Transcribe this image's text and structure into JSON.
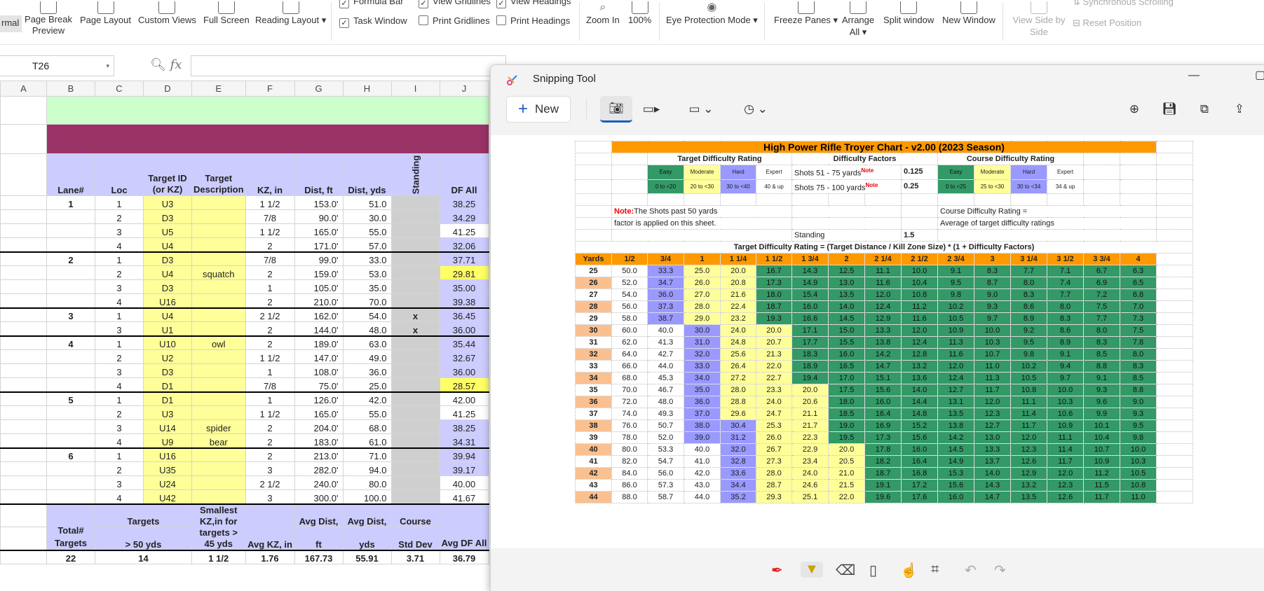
{
  "ribbon": {
    "normal": "rmal",
    "page_break": "Page Break Preview",
    "page_layout": "Page Layout",
    "custom_views": "Custom Views",
    "full_screen": "Full Screen",
    "reading_layout": "Reading Layout",
    "formula_bar": "Formula Bar",
    "task_window": "Task Window",
    "view_gridlines": "View Gridlines",
    "print_gridlines": "Print Gridlines",
    "view_headings": "View Headings",
    "print_headings": "Print Headings",
    "zoom_in": "Zoom In",
    "zoom_100": "100%",
    "eye_protection": "Eye Protection Mode",
    "freeze_panes": "Freeze Panes",
    "arrange_all": "Arrange All",
    "split_window": "Split window",
    "new_window": "New Window",
    "view_side": "View Side by Side",
    "sync_scroll": "Synchronous Scrolling",
    "reset_position": "Reset Position"
  },
  "formula": {
    "cell": "T26",
    "fx": "fx",
    "value": ""
  },
  "sheet": {
    "cols": [
      "A",
      "B",
      "C",
      "D",
      "E",
      "F",
      "G",
      "H",
      "I",
      "J"
    ],
    "headers": {
      "lane": "Lane#",
      "loc": "Loc",
      "target_id": "Target ID (or KZ)",
      "target_desc": "Target Description",
      "kz": "KZ, in",
      "dist_ft": "Dist, ft",
      "dist_yds": "Dist, yds",
      "standing": "Standing",
      "df": "DF All"
    },
    "rows": [
      {
        "lane": "1",
        "loc": "1",
        "id": "U3",
        "desc": "",
        "kz": "1  1/2",
        "ft": "153.0'",
        "yds": "51.0",
        "st": "",
        "df": "38.25",
        "dfc": "lb",
        "top": false
      },
      {
        "lane": "",
        "loc": "2",
        "id": "D3",
        "desc": "",
        "kz": "7/8",
        "ft": "90.0'",
        "yds": "30.0",
        "st": "",
        "df": "34.29",
        "dfc": "lb",
        "top": false
      },
      {
        "lane": "",
        "loc": "3",
        "id": "U5",
        "desc": "",
        "kz": "1  1/2",
        "ft": "165.0'",
        "yds": "55.0",
        "st": "",
        "df": "41.25",
        "dfc": "",
        "top": false
      },
      {
        "lane": "",
        "loc": "4",
        "id": "U4",
        "desc": "",
        "kz": "2",
        "ft": "171.0'",
        "yds": "57.0",
        "st": "",
        "df": "32.06",
        "dfc": "lb",
        "top": false
      },
      {
        "lane": "2",
        "loc": "1",
        "id": "D3",
        "desc": "",
        "kz": "7/8",
        "ft": "99.0'",
        "yds": "33.0",
        "st": "",
        "df": "37.71",
        "dfc": "lb",
        "top": true
      },
      {
        "lane": "",
        "loc": "2",
        "id": "U4",
        "desc": "squatch",
        "kz": "2",
        "ft": "159.0'",
        "yds": "53.0",
        "st": "",
        "df": "29.81",
        "dfc": "org",
        "top": false
      },
      {
        "lane": "",
        "loc": "3",
        "id": "D3",
        "desc": "",
        "kz": "1",
        "ft": "105.0'",
        "yds": "35.0",
        "st": "",
        "df": "35.00",
        "dfc": "lb",
        "top": false
      },
      {
        "lane": "",
        "loc": "4",
        "id": "U16",
        "desc": "",
        "kz": "2",
        "ft": "210.0'",
        "yds": "70.0",
        "st": "",
        "df": "39.38",
        "dfc": "lb",
        "top": false
      },
      {
        "lane": "3",
        "loc": "1",
        "id": "U4",
        "desc": "",
        "kz": "2  1/2",
        "ft": "162.0'",
        "yds": "54.0",
        "st": "x",
        "df": "36.45",
        "dfc": "lb",
        "top": true
      },
      {
        "lane": "",
        "loc": "3",
        "id": "U1",
        "desc": "",
        "kz": "2",
        "ft": "144.0'",
        "yds": "48.0",
        "st": "x",
        "df": "36.00",
        "dfc": "lb",
        "top": false
      },
      {
        "lane": "4",
        "loc": "1",
        "id": "U10",
        "desc": "owl",
        "kz": "2",
        "ft": "189.0'",
        "yds": "63.0",
        "st": "",
        "df": "35.44",
        "dfc": "lb",
        "top": true
      },
      {
        "lane": "",
        "loc": "2",
        "id": "U2",
        "desc": "",
        "kz": "1  1/2",
        "ft": "147.0'",
        "yds": "49.0",
        "st": "",
        "df": "32.67",
        "dfc": "lb",
        "top": false
      },
      {
        "lane": "",
        "loc": "3",
        "id": "D3",
        "desc": "",
        "kz": "1",
        "ft": "108.0'",
        "yds": "36.0",
        "st": "",
        "df": "36.00",
        "dfc": "lb",
        "top": false
      },
      {
        "lane": "",
        "loc": "4",
        "id": "D1",
        "desc": "",
        "kz": "7/8",
        "ft": "75.0'",
        "yds": "25.0",
        "st": "",
        "df": "28.57",
        "dfc": "org",
        "top": false
      },
      {
        "lane": "5",
        "loc": "1",
        "id": "D1",
        "desc": "",
        "kz": "1",
        "ft": "126.0'",
        "yds": "42.0",
        "st": "",
        "df": "42.00",
        "dfc": "",
        "top": true
      },
      {
        "lane": "",
        "loc": "2",
        "id": "U3",
        "desc": "",
        "kz": "1  1/2",
        "ft": "165.0'",
        "yds": "55.0",
        "st": "",
        "df": "41.25",
        "dfc": "",
        "top": false
      },
      {
        "lane": "",
        "loc": "3",
        "id": "U14",
        "desc": "spider",
        "kz": "2",
        "ft": "204.0'",
        "yds": "68.0",
        "st": "",
        "df": "38.25",
        "dfc": "lb",
        "top": false
      },
      {
        "lane": "",
        "loc": "4",
        "id": "U9",
        "desc": "bear",
        "kz": "2",
        "ft": "183.0'",
        "yds": "61.0",
        "st": "",
        "df": "34.31",
        "dfc": "lb",
        "top": false
      },
      {
        "lane": "6",
        "loc": "1",
        "id": "U16",
        "desc": "",
        "kz": "2",
        "ft": "213.0'",
        "yds": "71.0",
        "st": "",
        "df": "39.94",
        "dfc": "lb",
        "top": true
      },
      {
        "lane": "",
        "loc": "2",
        "id": "U35",
        "desc": "",
        "kz": "3",
        "ft": "282.0'",
        "yds": "94.0",
        "st": "",
        "df": "39.17",
        "dfc": "lb",
        "top": false
      },
      {
        "lane": "",
        "loc": "3",
        "id": "U24",
        "desc": "",
        "kz": "2  1/2",
        "ft": "240.0'",
        "yds": "80.0",
        "st": "",
        "df": "40.00",
        "dfc": "",
        "top": false
      },
      {
        "lane": "",
        "loc": "4",
        "id": "U42",
        "desc": "",
        "kz": "3",
        "ft": "300.0'",
        "yds": "100.0",
        "st": "",
        "df": "41.67",
        "dfc": "",
        "top": false
      }
    ],
    "summary_headers": {
      "total": "Total# Targets",
      "targets": "Targets",
      "targets2": "> 50 yds",
      "smallest": "Smallest KZ,in for targets > 45 yds",
      "avg_kz": "Avg KZ, in",
      "avg_dist_ft1": "Avg Dist,",
      "avg_dist_ft2": "ft",
      "avg_dist_yd1": "Avg Dist,",
      "avg_dist_yd2": "yds",
      "course1": "Course",
      "course2": "Std Dev",
      "avg_df": "Avg DF All"
    },
    "summary": {
      "total": "22",
      "targets": "14",
      "smallest": "1  1/2",
      "avg_kz": "1.76",
      "avg_ft": "167.73",
      "avg_yds": "55.91",
      "std": "3.71",
      "avg_df": "36.79"
    }
  },
  "snip": {
    "title": "Snipping Tool",
    "new_label": "New",
    "chart": {
      "title": "High Power Rifle Troyer Chart - v2.00 (2023 Season)",
      "tdr_title": "Target Difficulty Rating",
      "tdr": [
        {
          "name": "Easy",
          "range": "0 to <20"
        },
        {
          "name": "Moderate",
          "range": "20 to <30"
        },
        {
          "name": "Hard",
          "range": "30 to <40"
        },
        {
          "name": "Expert",
          "range": "40 & up"
        }
      ],
      "df_title": "Difficulty Factors",
      "df1_label": "Shots 51 - 75 yards",
      "df1_val": "0.125",
      "df2_label": "Shots 75 - 100 yards",
      "df2_val": "0.25",
      "note_sup": "Note",
      "cdr_title": "Course Difficulty Rating",
      "cdr": [
        {
          "name": "Easy",
          "range": "0 to <25"
        },
        {
          "name": "Moderate",
          "range": "25 to <30"
        },
        {
          "name": "Hard",
          "range": "30 to <34"
        },
        {
          "name": "Expert",
          "range": "34 & up"
        }
      ],
      "note_label": "Note:",
      "note1": "The Shots past 50 yards",
      "note2": "factor is applied on this sheet.",
      "cdr_eq": "Course Difficulty Rating =",
      "cdr_avg": "Average of target difficulty ratings",
      "standing_label": "Standing",
      "standing_val": "1.5",
      "formula": "Target Difficulty Rating = (Target Distance / Kill Zone Size) * (1 + Difficulty Factors)",
      "yards_label": "Yards",
      "kz_headers": [
        "1/2",
        "3/4",
        "1",
        "1 1/4",
        "1 1/2",
        "1 3/4",
        "2",
        "2 1/4",
        "2 1/2",
        "2 3/4",
        "3",
        "3 1/4",
        "3 1/2",
        "3 3/4",
        "4"
      ],
      "rows": [
        [
          "25",
          "50.0",
          "33.3",
          "25.0",
          "20.0",
          "16.7",
          "14.3",
          "12.5",
          "11.1",
          "10.0",
          "9.1",
          "8.3",
          "7.7",
          "7.1",
          "6.7",
          "6.3"
        ],
        [
          "26",
          "52.0",
          "34.7",
          "26.0",
          "20.8",
          "17.3",
          "14.9",
          "13.0",
          "11.6",
          "10.4",
          "9.5",
          "8.7",
          "8.0",
          "7.4",
          "6.9",
          "6.5"
        ],
        [
          "27",
          "54.0",
          "36.0",
          "27.0",
          "21.6",
          "18.0",
          "15.4",
          "13.5",
          "12.0",
          "10.8",
          "9.8",
          "9.0",
          "8.3",
          "7.7",
          "7.2",
          "6.8"
        ],
        [
          "28",
          "56.0",
          "37.3",
          "28.0",
          "22.4",
          "18.7",
          "16.0",
          "14.0",
          "12.4",
          "11.2",
          "10.2",
          "9.3",
          "8.6",
          "8.0",
          "7.5",
          "7.0"
        ],
        [
          "29",
          "58.0",
          "38.7",
          "29.0",
          "23.2",
          "19.3",
          "16.6",
          "14.5",
          "12.9",
          "11.6",
          "10.5",
          "9.7",
          "8.9",
          "8.3",
          "7.7",
          "7.3"
        ],
        [
          "30",
          "60.0",
          "40.0",
          "30.0",
          "24.0",
          "20.0",
          "17.1",
          "15.0",
          "13.3",
          "12.0",
          "10.9",
          "10.0",
          "9.2",
          "8.6",
          "8.0",
          "7.5"
        ],
        [
          "31",
          "62.0",
          "41.3",
          "31.0",
          "24.8",
          "20.7",
          "17.7",
          "15.5",
          "13.8",
          "12.4",
          "11.3",
          "10.3",
          "9.5",
          "8.9",
          "8.3",
          "7.8"
        ],
        [
          "32",
          "64.0",
          "42.7",
          "32.0",
          "25.6",
          "21.3",
          "18.3",
          "16.0",
          "14.2",
          "12.8",
          "11.6",
          "10.7",
          "9.8",
          "9.1",
          "8.5",
          "8.0"
        ],
        [
          "33",
          "66.0",
          "44.0",
          "33.0",
          "26.4",
          "22.0",
          "18.9",
          "16.5",
          "14.7",
          "13.2",
          "12.0",
          "11.0",
          "10.2",
          "9.4",
          "8.8",
          "8.3"
        ],
        [
          "34",
          "68.0",
          "45.3",
          "34.0",
          "27.2",
          "22.7",
          "19.4",
          "17.0",
          "15.1",
          "13.6",
          "12.4",
          "11.3",
          "10.5",
          "9.7",
          "9.1",
          "8.5"
        ],
        [
          "35",
          "70.0",
          "46.7",
          "35.0",
          "28.0",
          "23.3",
          "20.0",
          "17.5",
          "15.6",
          "14.0",
          "12.7",
          "11.7",
          "10.8",
          "10.0",
          "9.3",
          "8.8"
        ],
        [
          "36",
          "72.0",
          "48.0",
          "36.0",
          "28.8",
          "24.0",
          "20.6",
          "18.0",
          "16.0",
          "14.4",
          "13.1",
          "12.0",
          "11.1",
          "10.3",
          "9.6",
          "9.0"
        ],
        [
          "37",
          "74.0",
          "49.3",
          "37.0",
          "29.6",
          "24.7",
          "21.1",
          "18.5",
          "16.4",
          "14.8",
          "13.5",
          "12.3",
          "11.4",
          "10.6",
          "9.9",
          "9.3"
        ],
        [
          "38",
          "76.0",
          "50.7",
          "38.0",
          "30.4",
          "25.3",
          "21.7",
          "19.0",
          "16.9",
          "15.2",
          "13.8",
          "12.7",
          "11.7",
          "10.9",
          "10.1",
          "9.5"
        ],
        [
          "39",
          "78.0",
          "52.0",
          "39.0",
          "31.2",
          "26.0",
          "22.3",
          "19.5",
          "17.3",
          "15.6",
          "14.2",
          "13.0",
          "12.0",
          "11.1",
          "10.4",
          "9.8"
        ],
        [
          "40",
          "80.0",
          "53.3",
          "40.0",
          "32.0",
          "26.7",
          "22.9",
          "20.0",
          "17.8",
          "16.0",
          "14.5",
          "13.3",
          "12.3",
          "11.4",
          "10.7",
          "10.0"
        ],
        [
          "41",
          "82.0",
          "54.7",
          "41.0",
          "32.8",
          "27.3",
          "23.4",
          "20.5",
          "18.2",
          "16.4",
          "14.9",
          "13.7",
          "12.6",
          "11.7",
          "10.9",
          "10.3"
        ],
        [
          "42",
          "84.0",
          "56.0",
          "42.0",
          "33.6",
          "28.0",
          "24.0",
          "21.0",
          "18.7",
          "16.8",
          "15.3",
          "14.0",
          "12.9",
          "12.0",
          "11.2",
          "10.5"
        ],
        [
          "43",
          "86.0",
          "57.3",
          "43.0",
          "34.4",
          "28.7",
          "24.6",
          "21.5",
          "19.1",
          "17.2",
          "15.6",
          "14.3",
          "13.2",
          "12.3",
          "11.5",
          "10.8"
        ],
        [
          "44",
          "88.0",
          "58.7",
          "44.0",
          "35.2",
          "29.3",
          "25.1",
          "22.0",
          "19.6",
          "17.6",
          "16.0",
          "14.7",
          "13.5",
          "12.6",
          "11.7",
          "11.0"
        ]
      ]
    }
  }
}
